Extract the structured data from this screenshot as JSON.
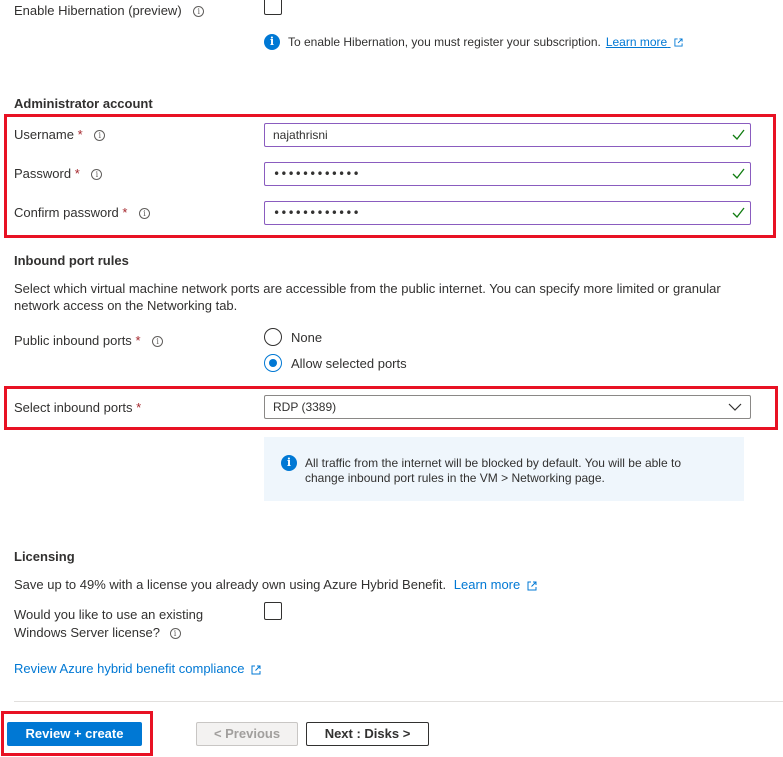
{
  "hibernation": {
    "label": "Enable Hibernation (preview)",
    "note": "To enable Hibernation, you must register your subscription.",
    "learn_more": "Learn more"
  },
  "admin": {
    "title": "Administrator account",
    "username_label": "Username",
    "username_value": "najathrisni",
    "password_label": "Password",
    "password_value": "••••••••••••",
    "confirm_label": "Confirm password",
    "confirm_value": "••••••••••••",
    "required_mark": "*"
  },
  "inbound": {
    "title": "Inbound port rules",
    "description_line1": "Select which virtual machine network ports are accessible from the public internet. You can specify more limited or granular",
    "description_line2": "network access on the Networking tab.",
    "public_ports_label": "Public inbound ports",
    "option_none": "None",
    "option_allow": "Allow selected ports",
    "selected_option": "Allow selected ports",
    "select_ports_label": "Select inbound ports",
    "select_ports_value": "RDP (3389)",
    "callout_line1": "All traffic from the internet will be blocked by default. You will be able to",
    "callout_line2": "change inbound port rules in the VM > Networking page."
  },
  "licensing": {
    "title": "Licensing",
    "text": "Save up to 49% with a license you already own using Azure Hybrid Benefit.",
    "learn_more": "Learn more",
    "question_line1": "Would you like to use an existing",
    "question_line2": "Windows Server license?",
    "compliance_link": "Review Azure hybrid benefit compliance"
  },
  "footer": {
    "review_create": "Review + create",
    "previous": "< Previous",
    "next": "Next : Disks >"
  },
  "colors": {
    "accent": "#0078d4",
    "highlight_border": "#e81123",
    "valid_check": "#107c10"
  }
}
